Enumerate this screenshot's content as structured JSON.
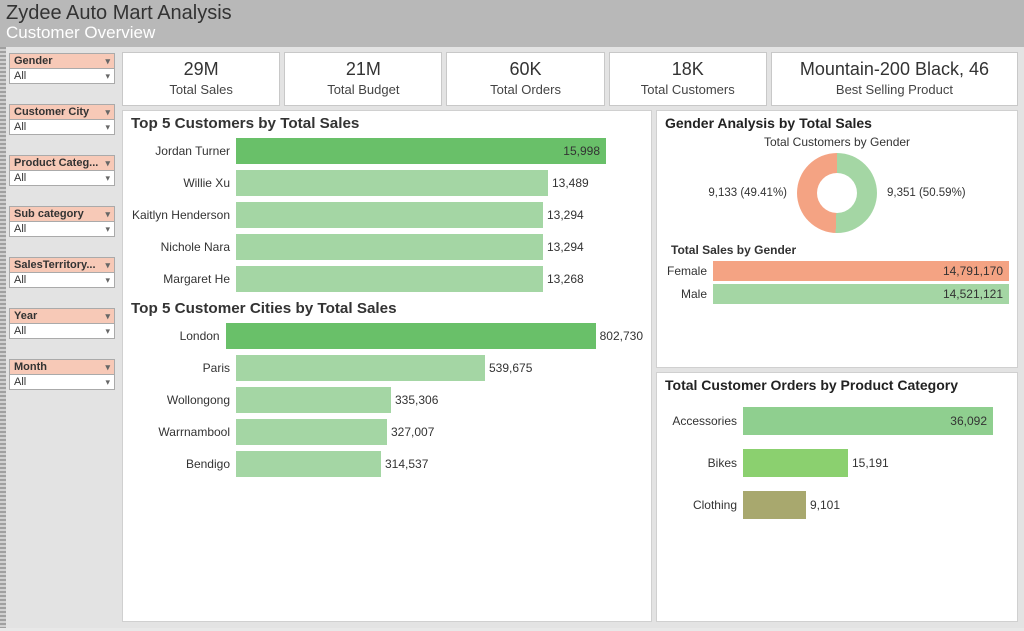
{
  "header": {
    "title": "Zydee Auto Mart Analysis",
    "subtitle": "Customer Overview"
  },
  "slicers": [
    {
      "label": "Gender",
      "value": "All"
    },
    {
      "label": "Customer City",
      "value": "All"
    },
    {
      "label": "Product Categ...",
      "value": "All"
    },
    {
      "label": "Sub category",
      "value": "All"
    },
    {
      "label": "SalesTerritory...",
      "value": "All"
    },
    {
      "label": "Year",
      "value": "All"
    },
    {
      "label": "Month",
      "value": "All"
    }
  ],
  "kpis": [
    {
      "value": "29M",
      "label": "Total Sales"
    },
    {
      "value": "21M",
      "label": "Total Budget"
    },
    {
      "value": "60K",
      "label": "Total Orders"
    },
    {
      "value": "18K",
      "label": "Total Customers"
    },
    {
      "value": "Mountain-200 Black, 46",
      "label": "Best Selling Product"
    }
  ],
  "top_customers": {
    "title": "Top 5 Customers by Total Sales",
    "rows": [
      {
        "name": "Jordan Turner",
        "value": 15998,
        "disp": "15,998"
      },
      {
        "name": "Willie Xu",
        "value": 13489,
        "disp": "13,489"
      },
      {
        "name": "Kaitlyn Henderson",
        "value": 13294,
        "disp": "13,294"
      },
      {
        "name": "Nichole Nara",
        "value": 13294,
        "disp": "13,294"
      },
      {
        "name": "Margaret He",
        "value": 13268,
        "disp": "13,268"
      }
    ],
    "max": 15998
  },
  "top_cities": {
    "title": "Top 5 Customer Cities by Total Sales",
    "rows": [
      {
        "name": "London",
        "value": 802730,
        "disp": "802,730"
      },
      {
        "name": "Paris",
        "value": 539675,
        "disp": "539,675"
      },
      {
        "name": "Wollongong",
        "value": 335306,
        "disp": "335,306"
      },
      {
        "name": "Warrnambool",
        "value": 327007,
        "disp": "327,007"
      },
      {
        "name": "Bendigo",
        "value": 314537,
        "disp": "314,537"
      }
    ],
    "max": 802730
  },
  "gender": {
    "title": "Gender Analysis by Total Sales",
    "donut_title": "Total Customers by Gender",
    "left_label": "9,133 (49.41%)",
    "right_label": "9,351 (50.59%)",
    "sales_title": "Total Sales by Gender",
    "female": {
      "label": "Female",
      "disp": "14,791,170"
    },
    "male": {
      "label": "Male",
      "disp": "14,521,121"
    }
  },
  "orders_by_category": {
    "title": "Total Customer Orders by Product Category",
    "rows": [
      {
        "name": "Accessories",
        "value": 36092,
        "disp": "36,092"
      },
      {
        "name": "Bikes",
        "value": 15191,
        "disp": "15,191"
      },
      {
        "name": "Clothing",
        "value": 9101,
        "disp": "9,101"
      }
    ],
    "max": 36092
  },
  "chart_data": [
    {
      "type": "bar",
      "orientation": "horizontal",
      "title": "Top 5 Customers by Total Sales",
      "categories": [
        "Jordan Turner",
        "Willie Xu",
        "Kaitlyn Henderson",
        "Nichole Nara",
        "Margaret He"
      ],
      "values": [
        15998,
        13489,
        13294,
        13294,
        13268
      ]
    },
    {
      "type": "bar",
      "orientation": "horizontal",
      "title": "Top 5 Customer Cities by Total Sales",
      "categories": [
        "London",
        "Paris",
        "Wollongong",
        "Warrnambool",
        "Bendigo"
      ],
      "values": [
        802730,
        539675,
        335306,
        327007,
        314537
      ]
    },
    {
      "type": "pie",
      "title": "Total Customers by Gender",
      "categories": [
        "Male",
        "Female"
      ],
      "values": [
        9351,
        9133
      ],
      "percentages": [
        50.59,
        49.41
      ]
    },
    {
      "type": "bar",
      "orientation": "horizontal",
      "title": "Total Sales by Gender",
      "categories": [
        "Female",
        "Male"
      ],
      "values": [
        14791170,
        14521121
      ]
    },
    {
      "type": "bar",
      "orientation": "horizontal",
      "title": "Total Customer Orders by Product Category",
      "categories": [
        "Accessories",
        "Bikes",
        "Clothing"
      ],
      "values": [
        36092,
        15191,
        9101
      ]
    }
  ]
}
